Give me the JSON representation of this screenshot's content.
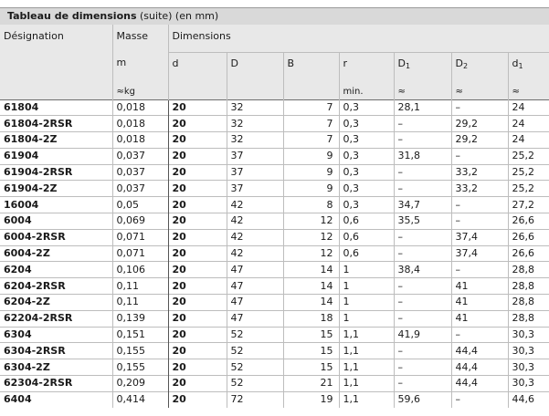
{
  "title": {
    "bold": "Tableau de dimensions",
    "rest": " (suite) (en mm)"
  },
  "header": {
    "designation": "Désignation",
    "masse": "Masse",
    "dimensions": "Dimensions",
    "m": "m",
    "kg": "≈kg",
    "d": "d",
    "D": "D",
    "B": "B",
    "r": "r",
    "r_min": "min.",
    "D1": "D",
    "D1_sub": "1",
    "D2": "D",
    "D2_sub": "2",
    "d1": "d",
    "d1_sub": "1",
    "approx": "≈"
  },
  "rows": [
    [
      "61804",
      "0,018",
      "20",
      "32",
      "7",
      "0,3",
      "28,1",
      "–",
      "24"
    ],
    [
      "61804-2RSR",
      "0,018",
      "20",
      "32",
      "7",
      "0,3",
      "–",
      "29,2",
      "24"
    ],
    [
      "61804-2Z",
      "0,018",
      "20",
      "32",
      "7",
      "0,3",
      "–",
      "29,2",
      "24"
    ],
    [
      "61904",
      "0,037",
      "20",
      "37",
      "9",
      "0,3",
      "31,8",
      "–",
      "25,2"
    ],
    [
      "61904-2RSR",
      "0,037",
      "20",
      "37",
      "9",
      "0,3",
      "–",
      "33,2",
      "25,2"
    ],
    [
      "61904-2Z",
      "0,037",
      "20",
      "37",
      "9",
      "0,3",
      "–",
      "33,2",
      "25,2"
    ],
    [
      "16004",
      "0,05",
      "20",
      "42",
      "8",
      "0,3",
      "34,7",
      "–",
      "27,2"
    ],
    [
      "6004",
      "0,069",
      "20",
      "42",
      "12",
      "0,6",
      "35,5",
      "–",
      "26,6"
    ],
    [
      "6004-2RSR",
      "0,071",
      "20",
      "42",
      "12",
      "0,6",
      "–",
      "37,4",
      "26,6"
    ],
    [
      "6004-2Z",
      "0,071",
      "20",
      "42",
      "12",
      "0,6",
      "–",
      "37,4",
      "26,6"
    ],
    [
      "6204",
      "0,106",
      "20",
      "47",
      "14",
      "1",
      "38,4",
      "–",
      "28,8"
    ],
    [
      "6204-2RSR",
      "0,11",
      "20",
      "47",
      "14",
      "1",
      "–",
      "41",
      "28,8"
    ],
    [
      "6204-2Z",
      "0,11",
      "20",
      "47",
      "14",
      "1",
      "–",
      "41",
      "28,8"
    ],
    [
      "62204-2RSR",
      "0,139",
      "20",
      "47",
      "18",
      "1",
      "–",
      "41",
      "28,8"
    ],
    [
      "6304",
      "0,151",
      "20",
      "52",
      "15",
      "1,1",
      "41,9",
      "–",
      "30,3"
    ],
    [
      "6304-2RSR",
      "0,155",
      "20",
      "52",
      "15",
      "1,1",
      "–",
      "44,4",
      "30,3"
    ],
    [
      "6304-2Z",
      "0,155",
      "20",
      "52",
      "15",
      "1,1",
      "–",
      "44,4",
      "30,3"
    ],
    [
      "62304-2RSR",
      "0,209",
      "20",
      "52",
      "21",
      "1,1",
      "–",
      "44,4",
      "30,3"
    ],
    [
      "6404",
      "0,414",
      "20",
      "72",
      "19",
      "1,1",
      "59,6",
      "–",
      "44,6"
    ]
  ]
}
